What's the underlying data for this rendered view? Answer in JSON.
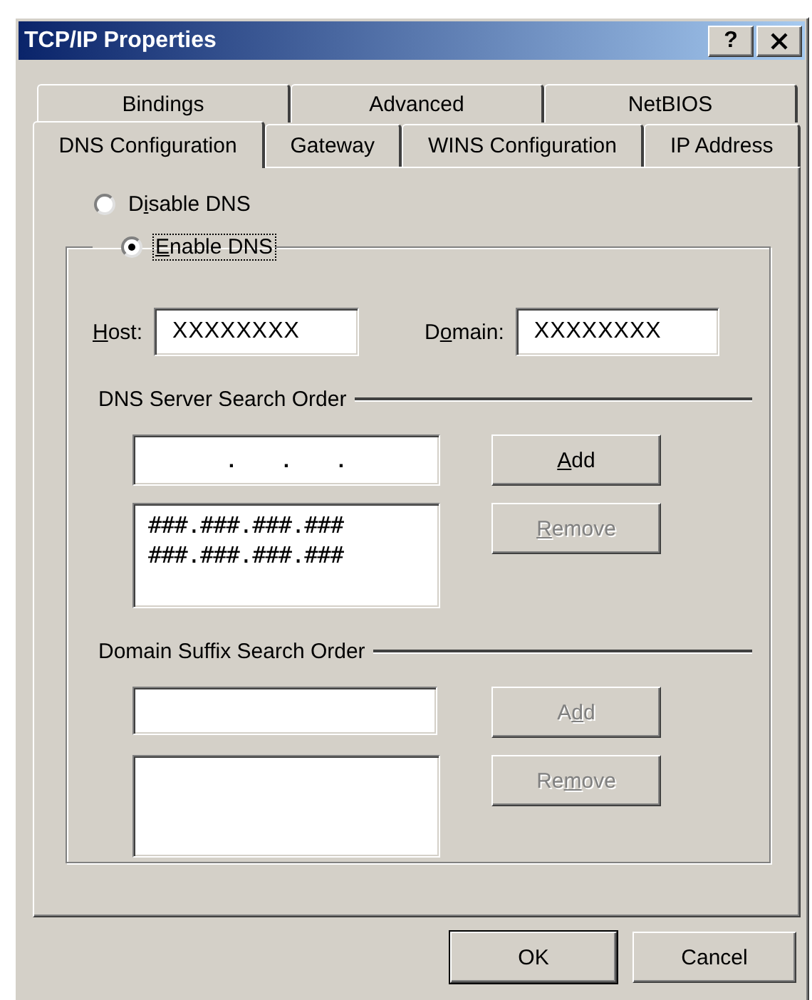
{
  "window": {
    "title": "TCP/IP Properties",
    "help_button": "?"
  },
  "tab_rows": [
    {
      "tabs": [
        {
          "label": "Bindings",
          "selected": false
        },
        {
          "label": "Advanced",
          "selected": false
        },
        {
          "label": "NetBIOS",
          "selected": false
        }
      ]
    },
    {
      "tabs": [
        {
          "label": "DNS Configuration",
          "selected": true
        },
        {
          "label": "Gateway",
          "selected": false
        },
        {
          "label": "WINS Configuration",
          "selected": false
        },
        {
          "label": "IP Address",
          "selected": false
        }
      ]
    }
  ],
  "dns_mode": [
    {
      "label": {
        "before": "D",
        "access_key": "i",
        "after": "sable DNS"
      },
      "selected": false,
      "focused": false
    },
    {
      "label": {
        "access_key": "E",
        "after": "nable DNS"
      },
      "selected": true,
      "focused": true
    }
  ],
  "host": {
    "label": {
      "access_key": "H",
      "after": "ost:"
    },
    "value": "XXXXXXXX"
  },
  "domain": {
    "label": {
      "before": "D",
      "access_key": "o",
      "after": "main:"
    },
    "value": "XXXXXXXX"
  },
  "dns_servers": {
    "title": "DNS Server Search Order",
    "ip_separators": [
      ".",
      ".",
      "."
    ],
    "items": [
      "###.###.###.###",
      "###.###.###.###"
    ],
    "buttons": [
      {
        "label": {
          "access_key": "A",
          "after": "dd"
        },
        "disabled": false
      },
      {
        "label": {
          "access_key": "R",
          "after": "emove"
        },
        "disabled": true
      }
    ]
  },
  "domain_suffixes": {
    "title": "Domain Suffix Search Order",
    "buttons": [
      {
        "label": {
          "before": "A",
          "access_key": "d",
          "after": "d"
        },
        "disabled": true
      },
      {
        "label": {
          "before": "Re",
          "access_key": "m",
          "after": "ove"
        },
        "disabled": true
      }
    ]
  },
  "buttons": [
    {
      "label": "OK",
      "default": true
    },
    {
      "label": "Cancel",
      "default": false
    }
  ]
}
